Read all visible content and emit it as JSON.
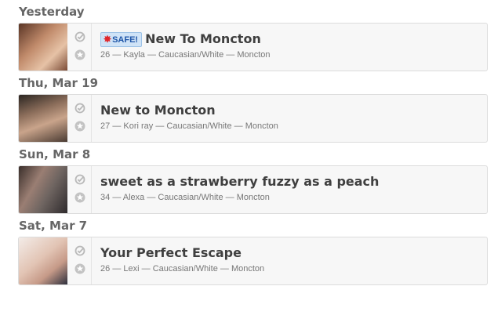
{
  "groups": [
    {
      "day": "Yesterday",
      "listing": {
        "badge": "SAFE!",
        "title": "New To Moncton",
        "age": "26",
        "name": "Kayla",
        "ethnicity": "Caucasian/White",
        "location": "Moncton",
        "sep": "—"
      }
    },
    {
      "day": "Thu, Mar 19",
      "listing": {
        "title": "New to Moncton",
        "age": "27",
        "name": "Kori ray",
        "ethnicity": "Caucasian/White",
        "location": "Moncton",
        "sep": "—"
      }
    },
    {
      "day": "Sun, Mar 8",
      "listing": {
        "title": "sweet as a strawberry fuzzy as a peach",
        "age": "34",
        "name": "Alexa",
        "ethnicity": "Caucasian/White",
        "location": "Moncton",
        "sep": "—"
      }
    },
    {
      "day": "Sat, Mar 7",
      "listing": {
        "title": "Your Perfect Escape",
        "age": "26",
        "name": "Lexi",
        "ethnicity": "Caucasian/White",
        "location": "Moncton",
        "sep": "—"
      }
    }
  ],
  "icons": {
    "check": "check-circle-icon",
    "star": "star-circle-icon",
    "badge_burst": "burst-icon"
  },
  "colors": {
    "badge_bg": "#cfe3f7",
    "badge_text": "#1f56a8",
    "badge_burst": "#e0262b",
    "card_bg": "#f7f7f7"
  }
}
